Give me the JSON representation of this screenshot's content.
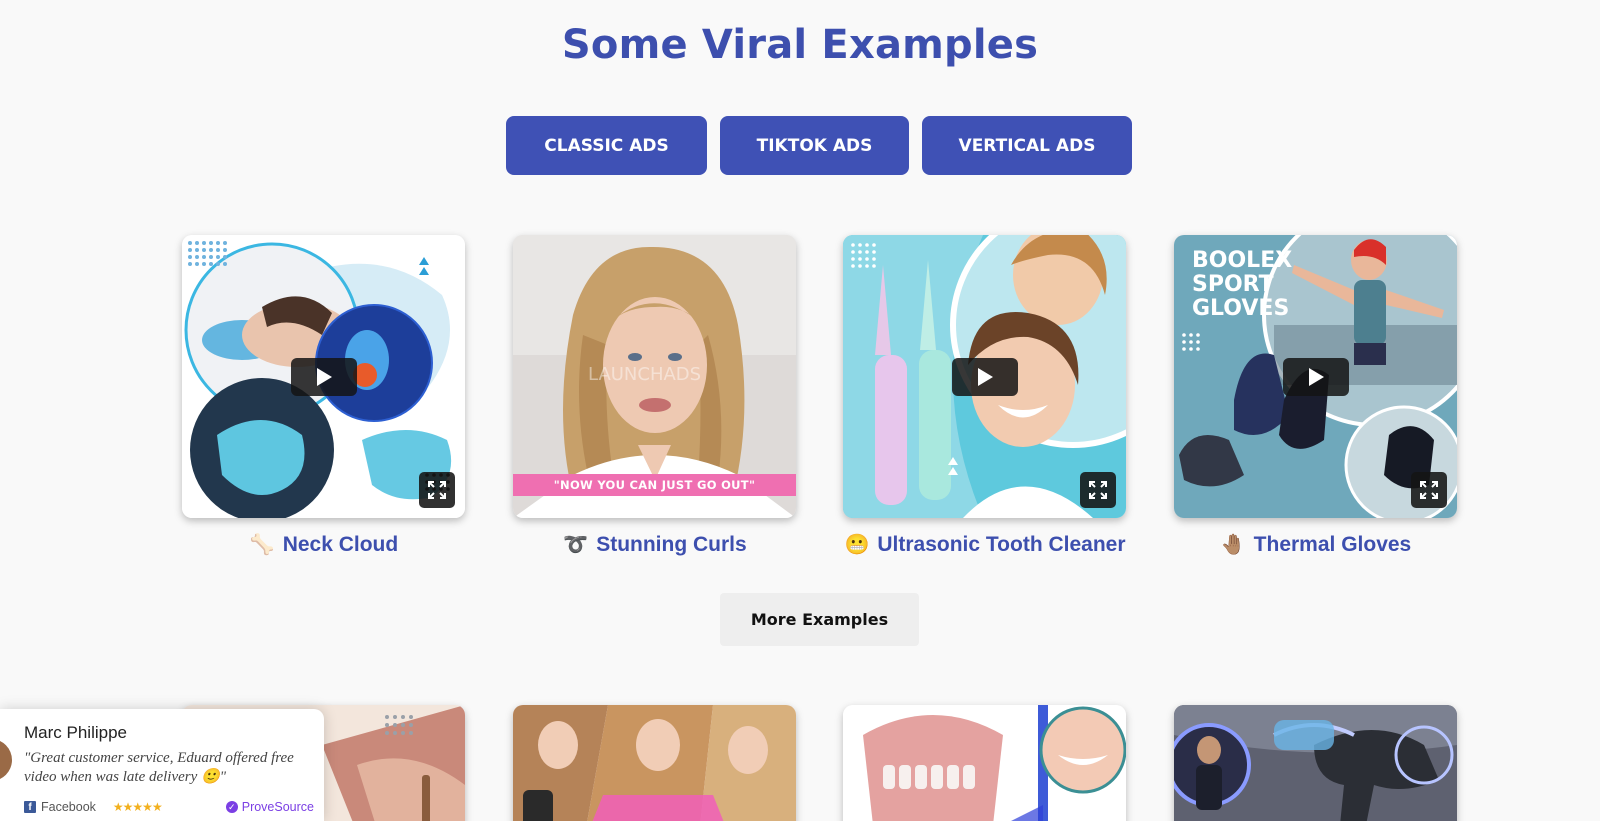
{
  "section": {
    "title": "Some Viral Examples"
  },
  "tabs": [
    {
      "label": "CLASSIC ADS"
    },
    {
      "label": "TIKTOK ADS"
    },
    {
      "label": "VERTICAL ADS"
    }
  ],
  "examples": [
    {
      "title": "Neck Cloud",
      "emoji": "🦴",
      "emoji_name": "bone-icon"
    },
    {
      "title": "Stunning Curls",
      "emoji": "➰",
      "emoji_name": "curly-loop-icon",
      "banner": "\"NOW YOU CAN JUST GO OUT\"",
      "watermark": "LAUNCHADS"
    },
    {
      "title": "Ultrasonic Tooth Cleaner",
      "emoji": "😬",
      "emoji_name": "grimacing-face-icon"
    },
    {
      "title": "Thermal Gloves",
      "emoji": "🤚🏽",
      "emoji_name": "hand-icon",
      "image_text": "BOOLEX SPORT GLOVES"
    }
  ],
  "more_button": {
    "label": "More Examples"
  },
  "notification": {
    "name": "Marc Philippe",
    "message": "\"Great customer service, Eduard offered free video when was late delivery 🙂\"",
    "source": "Facebook",
    "stars": "★★★★★",
    "provider": "ProveSource"
  },
  "colors": {
    "brand": "#3f51b5",
    "title": "#3d4fae",
    "banner_pink": "#ef6fb1",
    "background": "#f9f9f9"
  }
}
